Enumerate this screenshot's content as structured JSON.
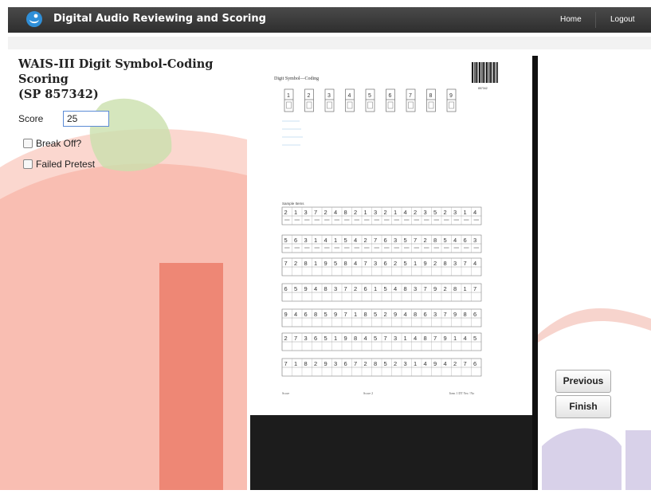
{
  "navbar": {
    "app_title": "Digital Audio Reviewing and Scoring",
    "home": "Home",
    "logout": "Logout"
  },
  "page": {
    "heading": "WAIS-III Digit Symbol-Coding Scoring\n(SP 857342)"
  },
  "score": {
    "label": "Score",
    "value": "25"
  },
  "options": {
    "break_off": "Break Off?",
    "failed_pretest": "Failed Pretest"
  },
  "doc": {
    "title": "Digit Symbol—Coding",
    "barcode_number": "857342",
    "key_digits": [
      "1",
      "2",
      "3",
      "4",
      "5",
      "6",
      "7",
      "8",
      "9"
    ],
    "sample_label": "Sample Items",
    "rows": [
      "2137248213214235231 4",
      "563141542763572854 63",
      "7281958473625192837 4",
      "6594837261548379281 7",
      "9468597185294863798 6",
      "2736519845731487914 5",
      "7182936728523149427 6"
    ],
    "footer_left": "Score",
    "footer_mid": "Score 2",
    "footer_right": "Item 1 DT  Yes / No"
  },
  "buttons": {
    "previous": "Previous",
    "finish": "Finish"
  },
  "colors": {
    "accent": "#2f8fd8",
    "brand_red": "#d2232a",
    "brand_green": "#5aa02c",
    "brand_purple": "#6a4fa0"
  }
}
